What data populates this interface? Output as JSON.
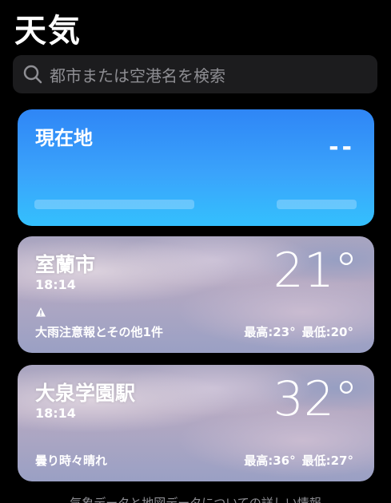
{
  "app": {
    "title": "天気"
  },
  "search": {
    "placeholder": "都市または空港名を検索"
  },
  "locations": [
    {
      "name": "現在地",
      "temp": "--"
    },
    {
      "name": "室蘭市",
      "time": "18:14",
      "temp": "21°",
      "condition": "大雨注意報とその他1件",
      "high": "最高:23°",
      "low": "最低:20°",
      "warning_icon": "warning-triangle-icon"
    },
    {
      "name": "大泉学園駅",
      "time": "18:14",
      "temp": "32°",
      "condition": "曇り時々晴れ",
      "high": "最高:36°",
      "low": "最低:27°"
    }
  ],
  "footer": {
    "text": "気象データと地図データについての詳しい情報"
  },
  "colors": {
    "location_card_top": "#2f86f6",
    "location_card_bottom": "#34c0fd",
    "search_bg": "#1c1c1e",
    "placeholder": "#8e8e93"
  }
}
